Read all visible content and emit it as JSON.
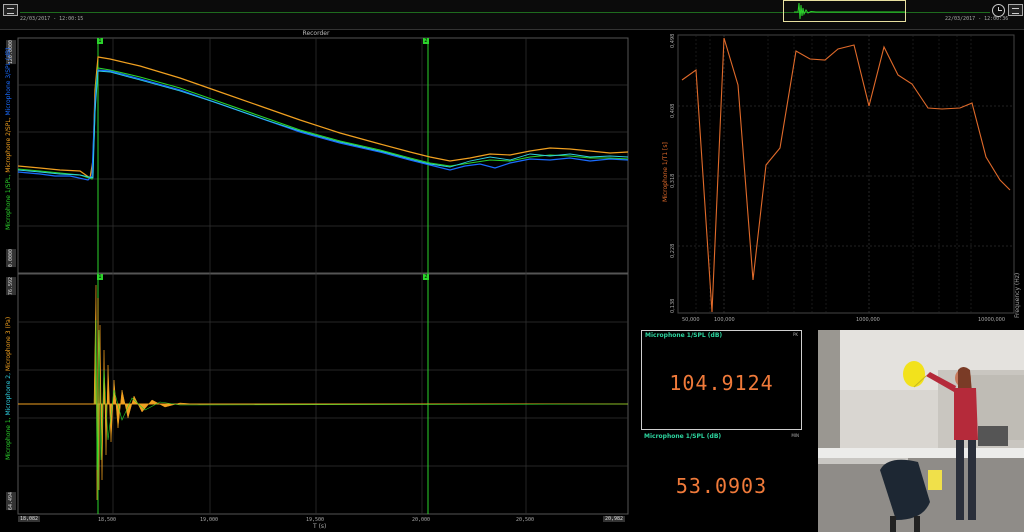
{
  "timeline": {
    "start_time": "22/03/2017 - 12:00:15",
    "end_time": "22/03/2017 - 12:00:36"
  },
  "recorder": {
    "title": "Recorder",
    "top_plot": {
      "y_label_1": "Microphone 1/SPL, ",
      "y_label_2": "Microphone 2/SPL, ",
      "y_label_3": "Microphone 3/SPL (dB)",
      "y_max": "120.0000",
      "y_min": "0.0000",
      "y_tick_mid": "76.592"
    },
    "bottom_plot": {
      "y_label_1": "Microphone 1, ",
      "y_label_2": "Microphone 2, ",
      "y_label_3": "Microphone 3 (Pa)",
      "y_min": "64.494"
    },
    "x_axis": {
      "title": "T (s)",
      "start": "18,082",
      "end": "20,982",
      "ticks": [
        "18,500",
        "19,000",
        "19,500",
        "20,000",
        "20,500"
      ]
    },
    "cursors": [
      "1",
      "2"
    ]
  },
  "frequency": {
    "y_label": "Microphone 1/T1 [s]",
    "x_label": "Frequency (Hz)",
    "y_ticks": [
      "0,498",
      "0,408",
      "0,318",
      "0,228",
      "0,138"
    ],
    "x_ticks": [
      "50,000",
      "100,000",
      "1000,000",
      "10000,000"
    ]
  },
  "meter_pk": {
    "title": "Microphone 1/SPL (dB)",
    "mode": "PK",
    "value": "104.9124"
  },
  "meter_min": {
    "title": "Microphone 1/SPL (dB)",
    "mode": "MIN",
    "value": "53.0903"
  },
  "colors": {
    "mic1": "#2bd32b",
    "mic2": "#1a6cff",
    "mic3": "#f0a020",
    "cyan": "#2fd0e0",
    "freq": "#e06a2a",
    "cursor": "#2bd32b"
  }
}
